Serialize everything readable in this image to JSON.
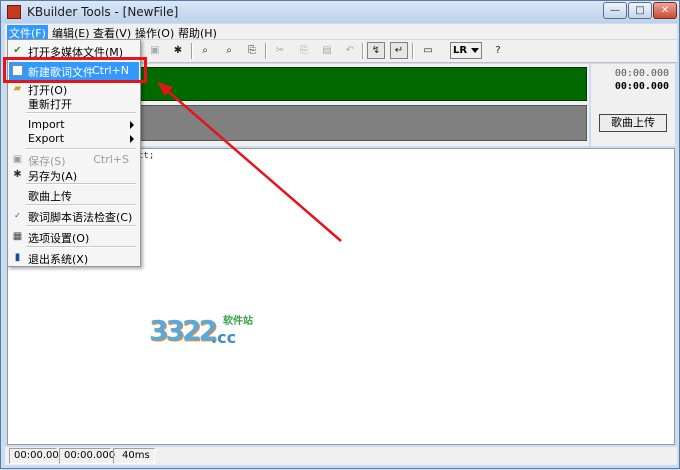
{
  "window": {
    "title": "KBuilder Tools - [NewFile]",
    "minimize": "—",
    "maximize": "□",
    "close": "✕"
  },
  "menubar": [
    "文件(F)",
    "编辑(E)",
    "查看(V)",
    "操作(O)",
    "帮助(H)"
  ],
  "toolbar": {
    "lr_label": "LR"
  },
  "time": {
    "top": "00:00.000",
    "main": "00:00.000"
  },
  "upload_button": "歌曲上传",
  "editor_text": "ct;",
  "file_menu": [
    {
      "label": "打开多媒体文件(M)",
      "shortcut": "",
      "icon": "open-media-icon"
    },
    {
      "label": "新建歌词文件",
      "shortcut": "Ctrl+N",
      "icon": "new-file-icon"
    },
    {
      "label": "打开(O)",
      "shortcut": "",
      "icon": "open-folder-icon"
    },
    {
      "label": "重新打开",
      "shortcut": "",
      "icon": ""
    },
    {
      "label": "Import",
      "shortcut": "",
      "icon": ""
    },
    {
      "label": "Export",
      "shortcut": "",
      "icon": ""
    },
    {
      "label": "保存(S)",
      "shortcut": "Ctrl+S",
      "icon": "save-icon"
    },
    {
      "label": "另存为(A)",
      "shortcut": "",
      "icon": "save-as-icon"
    },
    {
      "label": "歌曲上传",
      "shortcut": "",
      "icon": ""
    },
    {
      "label": "歌词脚本语法检查(C)",
      "shortcut": "",
      "icon": "spell-check-icon"
    },
    {
      "label": "选项设置(O)",
      "shortcut": "",
      "icon": "options-icon"
    },
    {
      "label": "退出系统(X)",
      "shortcut": "",
      "icon": "exit-icon"
    }
  ],
  "statusbar": [
    "00:00.00",
    "00:00.000",
    "40ms"
  ],
  "watermark": {
    "digits": "3322",
    "suffix": ".cc",
    "site": "软件站"
  },
  "colors": {
    "highlight": "#3399ff",
    "annotation": "#e8121b",
    "lyric_green": "#006a00"
  }
}
